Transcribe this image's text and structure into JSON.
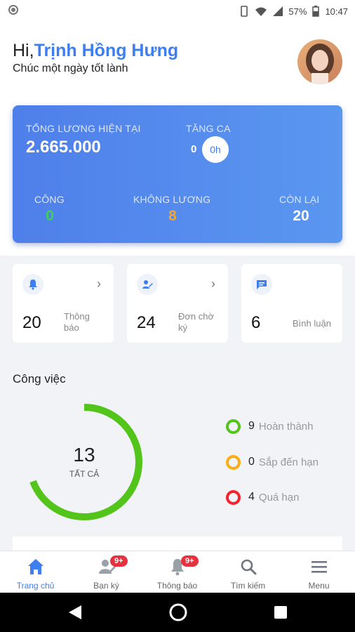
{
  "status_bar": {
    "battery": "57%",
    "time": "10:47"
  },
  "header": {
    "hi": "Hi,",
    "name": "Trịnh Hồng Hưng",
    "subtitle": "Chúc một ngày tốt lành"
  },
  "salary_card": {
    "total_label": "TỔNG LƯƠNG HIỆN TẠI",
    "total_value": "2.665.000",
    "overtime_label": "TĂNG CA",
    "overtime_count": "0",
    "overtime_hours": "0h",
    "work_label": "CÔNG",
    "work_value": "0",
    "unpaid_label": "KHÔNG LƯƠNG",
    "unpaid_value": "8",
    "remaining_label": "CÒN LẠI",
    "remaining_value": "20",
    "colors": {
      "work": "#3ecf5a",
      "unpaid": "#f0a53a"
    }
  },
  "tiles": [
    {
      "count": "20",
      "label_line1": "Thông",
      "label_line2": "báo",
      "icon": "bell-icon"
    },
    {
      "count": "24",
      "label_line1": "Đơn chờ",
      "label_line2": "ký",
      "icon": "sign-icon"
    },
    {
      "count": "6",
      "label_line1": "Bình luận",
      "label_line2": "",
      "icon": "comment-icon"
    }
  ],
  "work": {
    "title": "Công việc",
    "total": "13",
    "total_label": "TẤT CẢ",
    "completed_fraction": 0.6923,
    "overdue_fraction": 0.3077,
    "legend": [
      {
        "count": "9",
        "label": "Hoàn thành",
        "color": "#52c41a"
      },
      {
        "count": "0",
        "label": "Sắp đến hạn",
        "color": "#faad14"
      },
      {
        "count": "4",
        "label": "Quá hạn",
        "color": "#f5222d"
      }
    ]
  },
  "bottom_nav": [
    {
      "label": "Trang chủ",
      "icon": "home-icon",
      "active": true
    },
    {
      "label": "Bạn ký",
      "icon": "user-sign-icon",
      "badge": "9+"
    },
    {
      "label": "Thông báo",
      "icon": "bell-icon",
      "badge": "9+"
    },
    {
      "label": "Tìm kiếm",
      "icon": "search-icon"
    },
    {
      "label": "Menu",
      "icon": "menu-icon"
    }
  ],
  "accent": "#3d7ff0"
}
